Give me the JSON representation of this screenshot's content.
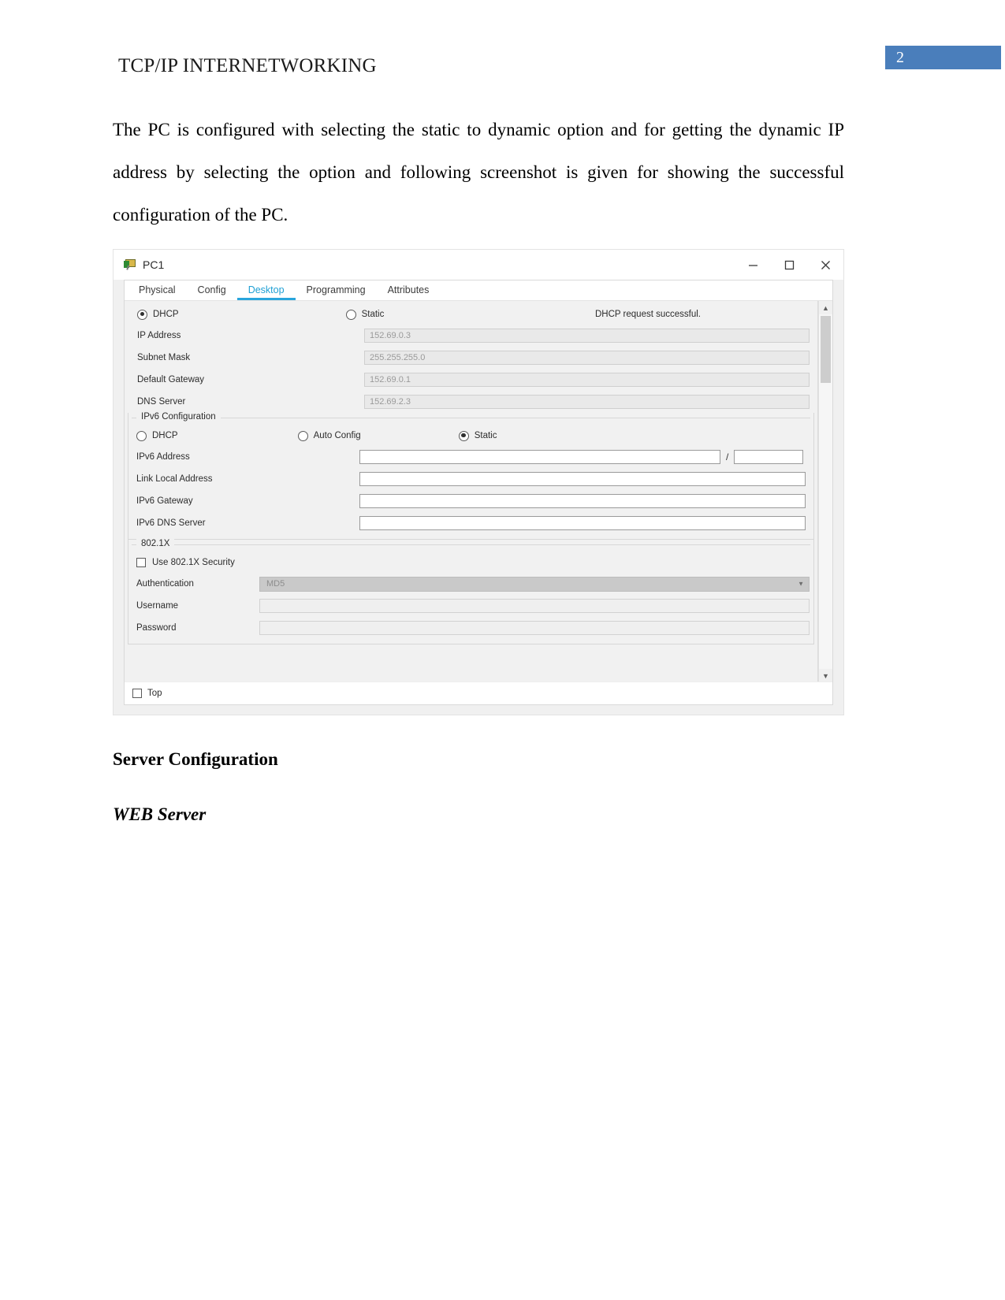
{
  "document": {
    "header_title": "TCP/IP INTERNETWORKING",
    "page_number": "2",
    "badge_color": "#4a7ebb",
    "paragraph": "The PC is configured with selecting the static to dynamic option and for getting the dynamic IP address by selecting the option and following screenshot is given for showing the successful configuration of the PC.",
    "heading_server_configuration": "Server Configuration",
    "heading_web_server": "WEB Server"
  },
  "pt_window": {
    "title": "PC1",
    "title_icon": "pc-device-icon",
    "controls": {
      "minimize": "minimize-icon",
      "maximize": "maximize-icon",
      "close": "close-icon"
    },
    "tabs": [
      {
        "label": "Physical",
        "active": false
      },
      {
        "label": "Config",
        "active": false
      },
      {
        "label": "Desktop",
        "active": true
      },
      {
        "label": "Programming",
        "active": false
      },
      {
        "label": "Attributes",
        "active": false
      }
    ],
    "active_tab_color": "#29a5dc",
    "ip_configuration": {
      "dhcp_label": "DHCP",
      "dhcp_selected": true,
      "static_label": "Static",
      "static_selected": false,
      "status_text": "DHCP request successful.",
      "fields": [
        {
          "label": "IP Address",
          "value": "152.69.0.3"
        },
        {
          "label": "Subnet Mask",
          "value": "255.255.255.0"
        },
        {
          "label": "Default Gateway",
          "value": "152.69.0.1"
        },
        {
          "label": "DNS Server",
          "value": "152.69.2.3"
        }
      ]
    },
    "ipv6_configuration": {
      "group_title": "IPv6 Configuration",
      "radios": [
        {
          "label": "DHCP",
          "selected": false
        },
        {
          "label": "Auto Config",
          "selected": false
        },
        {
          "label": "Static",
          "selected": true
        }
      ],
      "address_label": "IPv6 Address",
      "address_value": "",
      "prefix_separator": "/",
      "prefix_value": "",
      "fields": [
        {
          "label": "Link Local Address",
          "value": ""
        },
        {
          "label": "IPv6 Gateway",
          "value": ""
        },
        {
          "label": "IPv6 DNS Server",
          "value": ""
        }
      ]
    },
    "dot1x": {
      "group_title": "802.1X",
      "use_security_label": "Use 802.1X Security",
      "use_security_checked": false,
      "authentication_label": "Authentication",
      "authentication_value": "MD5",
      "username_label": "Username",
      "username_value": "",
      "password_label": "Password",
      "password_value": ""
    },
    "footer": {
      "top_label": "Top",
      "top_checked": false
    }
  }
}
